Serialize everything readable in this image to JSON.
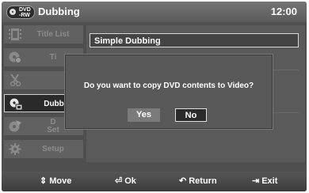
{
  "header": {
    "disc_top": "DVD",
    "disc_bottom": "-RW",
    "title": "Dubbing",
    "clock": "12:00"
  },
  "sidebar": {
    "items": [
      {
        "label": "Title List",
        "icon": "film-strip-icon",
        "active": false
      },
      {
        "label": "Ti",
        "icon": "disc-gear-icon",
        "active": false
      },
      {
        "label": "",
        "icon": "scissors-icon",
        "active": false
      },
      {
        "label": "Dubb",
        "icon": "dubbing-icon",
        "active": true
      },
      {
        "label": "D\nSet",
        "icon": "disc-settings-icon",
        "active": false
      },
      {
        "label": "Setup",
        "icon": "gear-icon",
        "active": false
      }
    ]
  },
  "panel": {
    "title": "Simple Dubbing"
  },
  "dialog": {
    "message": "Do you want to copy DVD contents to Video?",
    "yes_label": "Yes",
    "no_label": "No"
  },
  "footer": {
    "move": "Move",
    "ok": "Ok",
    "return": "Return",
    "exit": "Exit"
  },
  "colors": {
    "background": "#4f4f4f",
    "highlight_border": "#e0e0e0",
    "text": "#ffffff"
  }
}
